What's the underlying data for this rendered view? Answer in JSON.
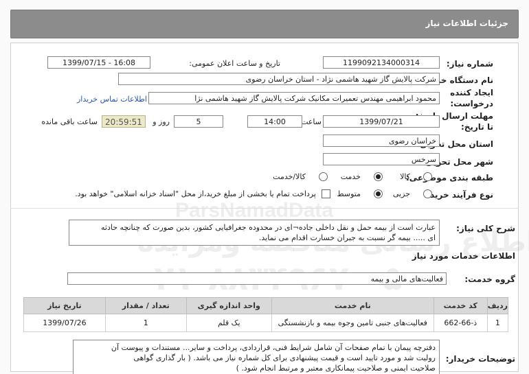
{
  "header": {
    "title": "جزئیات اطلاعات نیاز"
  },
  "fields": {
    "need_number_label": "شماره نیاز:",
    "need_number": "1199092134000314",
    "announce_label": "تاریخ و ساعت اعلان عمومی:",
    "announce_value": "1399/07/15 - 16:08",
    "buyer_label": "نام دستگاه خریدار:",
    "buyer_value": "شرکت پالایش گاز شهید هاشمی نژاد - استان خراسان رضوی",
    "creator_label_1": "ایجاد کننده",
    "creator_label_2": "درخواست:",
    "creator_value": "محمود ابراهیمی مهندس تعمیرات مکانیک شرکت پالایش گاز شهید هاشمی نژا",
    "contact_link": "اطلاعات تماس خریدار",
    "deadline_label_1": "مهلت ارسال پاسخ:",
    "deadline_label_2": "تا تاریخ:",
    "deadline_date": "1399/07/21",
    "time_label": "ساعت",
    "deadline_time": "14:00",
    "days_value": "5",
    "days_label": "روز و",
    "remaining_time": "20:59:51",
    "remaining_label": "ساعت باقی مانده",
    "province_label": "استان محل تحویل:",
    "province_value": "خراسان رضوی",
    "city_label": "شهر محل تحویل:",
    "city_value": "سرخس",
    "category_label": "طبقه بندی موضوعی:",
    "category_options": [
      "کالا",
      "خدمت",
      "کالا/خدمت"
    ],
    "process_label": "نوع فرآیند خرید :",
    "process_options": [
      "جزیی",
      "متوسط"
    ],
    "payment_note": "پرداخت تمام یا بخشی از مبلغ خرید،از محل \"اسناد خزانه اسلامی\" خواهد بود."
  },
  "summary": {
    "label": "شرح کلی نیاز:",
    "line1": "عبارت است از بیمه حمل و نقل داخلی جاده¬ای در محدوده جغرافیایی کشور، بدین صورت که چنانچه حادثه",
    "line2": "ای ..... بیمه گر نسبت به جبران خسارت اقدام می نماید."
  },
  "services": {
    "section_title": "اطلاعات خدمات مورد نیاز",
    "group_label": "گروه خدمت:",
    "group_value": "فعالیت‌های مالی و بیمه",
    "columns": [
      "ردیف",
      "کد خدمت",
      "نام خدمت",
      "واحد اندازه گیری",
      "تعداد / مقدار",
      "تاریخ نیاز"
    ],
    "rows": [
      [
        "1",
        "ذ-66-662",
        "فعالیت‌های جنبی تامین وجوه بیمه و بازنشستگی",
        "یک قلم",
        "1",
        "1399/07/26"
      ]
    ]
  },
  "notes": {
    "label": "توضیحات خریدار:",
    "line1": "دفترچه پیمان با تمام صفحات آن شامل شرایط فنی، قراردادی، پرداخت و سایر...  مستندات و پیوست آن",
    "line2": "رولیت شد و مورد تایید است  و قیمت پیشنهادی برای کل شماره نیاز می باشد. ( بار گذاری گواهی",
    "line3": "صلاحیت ایمنی و صلاحیت پیمانکاری معتبر و مرتبط انجام شود. )"
  },
  "watermark": {
    "line1": "ParsNamadData",
    "line2": "پایگاه اطلاع رسانی مناقصه ومزایده",
    "line3": "۰۲۱-۸۸۳۴۹۶۷۰-۵"
  }
}
